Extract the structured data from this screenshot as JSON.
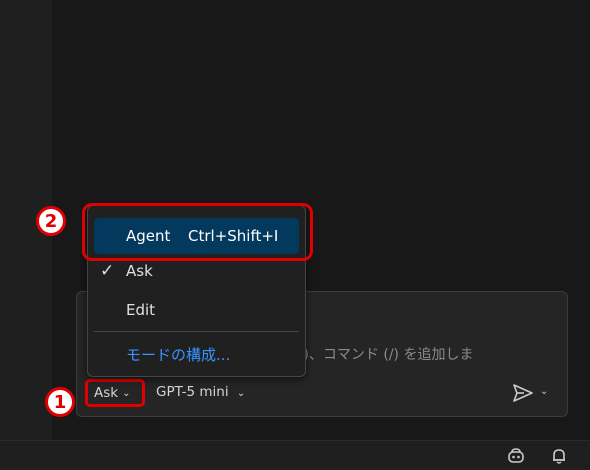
{
  "chat": {
    "placeholder": "(@)、コマンド (/) を追加しま"
  },
  "toolbar": {
    "mode_label": "Ask",
    "model_label": "GPT-5 mini"
  },
  "mode_menu": {
    "items": [
      {
        "label": "Agent",
        "shortcut": "Ctrl+Shift+I",
        "highlighted": true
      },
      {
        "label": "Ask",
        "checked": true
      },
      {
        "label": "Edit"
      }
    ],
    "configure_label": "モードの構成..."
  },
  "annotations": {
    "badge_1": "1",
    "badge_2": "2",
    "color": "#e00000"
  },
  "icons": {
    "send": "send-icon",
    "copilot": "copilot-icon",
    "bell": "bell-icon"
  }
}
